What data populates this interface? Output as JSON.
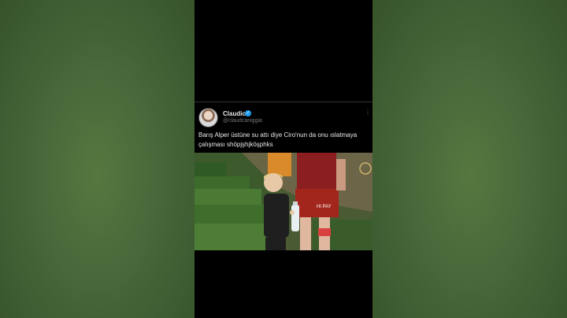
{
  "tweet": {
    "author_name": "Claudio",
    "author_handle": "@claudcaniggia",
    "text": "Barış Alper üstüne su attı diye Ciro'nun da onu ıslatmaya çalışması shöpjşhjköşphks",
    "verified_icon": "✓",
    "more_icon": "⋮"
  },
  "media": {
    "jersey_text": "HI PAY",
    "description_icon": "video-frame"
  },
  "colors": {
    "background_green": "#47683a",
    "frame_black": "#000000",
    "verified_blue": "#1d9bf0",
    "text_primary": "#e7e9ea",
    "text_secondary": "#71767b"
  }
}
